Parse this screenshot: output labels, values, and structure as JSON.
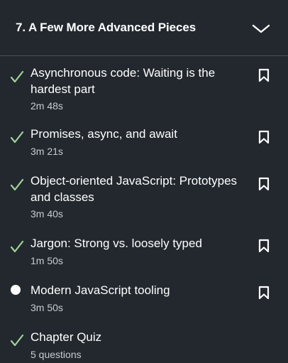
{
  "chapter": {
    "title": "7. A Few More Advanced Pieces",
    "expand_icon": "chevron-down-icon"
  },
  "colors": {
    "background": "#22282e",
    "check": "#9fd39a",
    "text": "#ffffff",
    "meta": "#c8ccd0",
    "divider": "#4a5157"
  },
  "items": [
    {
      "title": "Asynchronous code: Waiting is the hardest part",
      "meta": "2m 48s",
      "status": "completed",
      "status_icon": "checkmark-icon",
      "bookmark_icon": "bookmark-icon"
    },
    {
      "title": "Promises, async, and await",
      "meta": "3m 21s",
      "status": "completed",
      "status_icon": "checkmark-icon",
      "bookmark_icon": "bookmark-icon"
    },
    {
      "title": "Object-oriented JavaScript: Prototypes and classes",
      "meta": "3m 40s",
      "status": "completed",
      "status_icon": "checkmark-icon",
      "bookmark_icon": "bookmark-icon"
    },
    {
      "title": "Jargon: Strong vs. loosely typed",
      "meta": "1m 50s",
      "status": "completed",
      "status_icon": "checkmark-icon",
      "bookmark_icon": "bookmark-icon"
    },
    {
      "title": "Modern JavaScript tooling",
      "meta": "3m 50s",
      "status": "current",
      "status_icon": "current-dot-icon",
      "bookmark_icon": "bookmark-icon"
    },
    {
      "title": "Chapter Quiz",
      "meta": "5 questions",
      "status": "completed",
      "status_icon": "checkmark-icon",
      "bookmark_icon": ""
    }
  ]
}
